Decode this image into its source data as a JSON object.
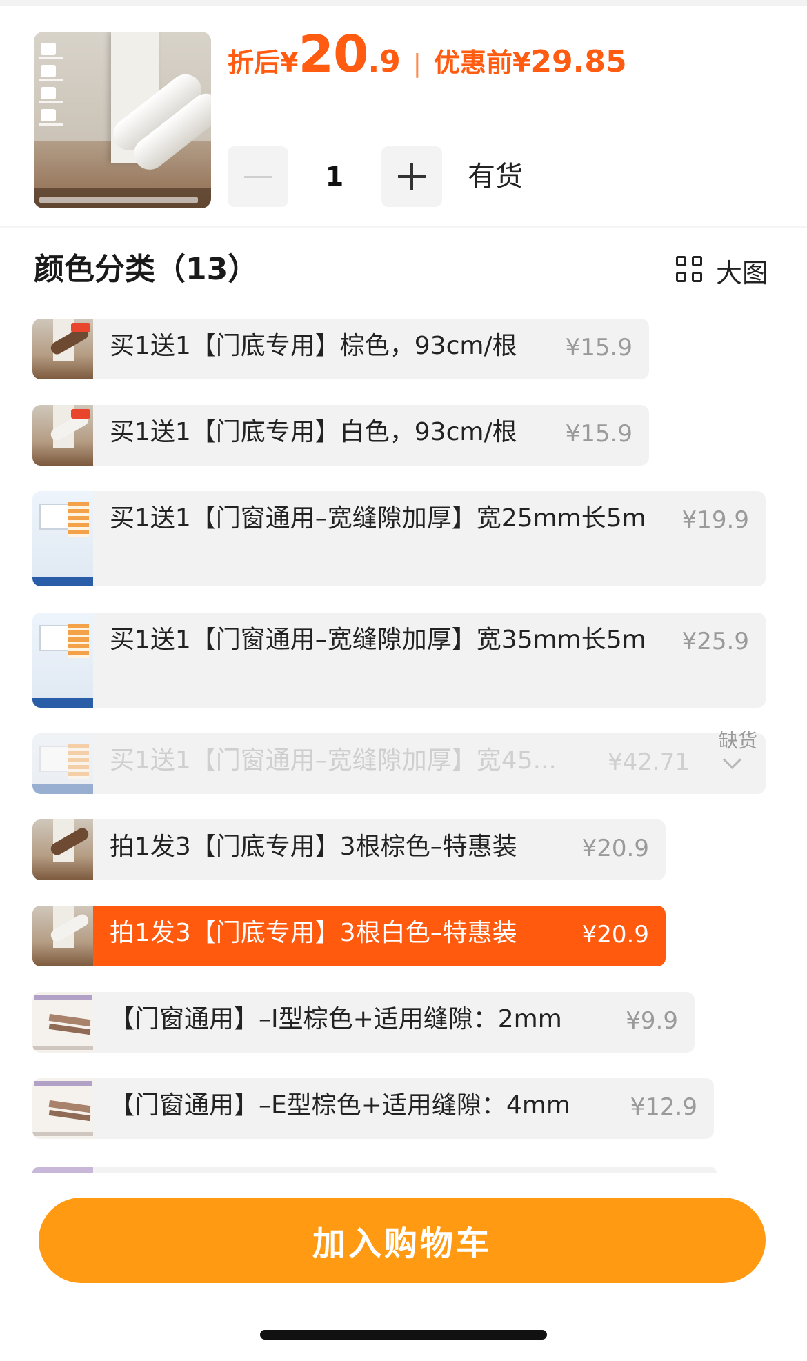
{
  "header": {
    "price_prefix": "折后",
    "currency": "¥",
    "price_int": "20",
    "price_dec": ".9",
    "separator": "|",
    "orig_prefix": "优惠前",
    "orig_price": "29.85",
    "quantity": "1",
    "stock_status": "有货"
  },
  "section": {
    "title": "颜色分类（13）",
    "big_view_label": "大图"
  },
  "options": [
    {
      "label": "买1送1【门底专用】棕色，93cm/根",
      "price": "¥15.9",
      "state": "normal"
    },
    {
      "label": "买1送1【门底专用】白色，93cm/根",
      "price": "¥15.9",
      "state": "normal"
    },
    {
      "label": "买1送1【门窗通用–宽缝隙加厚】宽25mm长5m",
      "price": "¥19.9",
      "state": "normal"
    },
    {
      "label": "买1送1【门窗通用–宽缝隙加厚】宽35mm长5m",
      "price": "¥25.9",
      "state": "normal"
    },
    {
      "label": "买1送1【门窗通用–宽缝隙加厚】宽45...",
      "price": "¥42.71",
      "state": "out_of_stock",
      "tag": "缺货"
    },
    {
      "label": "拍1发3【门底专用】3根棕色–特惠装",
      "price": "¥20.9",
      "state": "normal"
    },
    {
      "label": "拍1发3【门底专用】3根白色–特惠装",
      "price": "¥20.9",
      "state": "selected"
    },
    {
      "label": "【门窗通用】–I型棕色+适用缝隙：2mm",
      "price": "¥9.9",
      "state": "normal"
    },
    {
      "label": "【门窗通用】–E型棕色+适用缝隙：4mm",
      "price": "¥12.9",
      "state": "normal"
    }
  ],
  "footer": {
    "add_to_cart_label": "加入购物车"
  },
  "colors": {
    "accent": "#ff5a0e",
    "cart_button": "#ff9a12",
    "option_bg": "#f2f2f2"
  }
}
